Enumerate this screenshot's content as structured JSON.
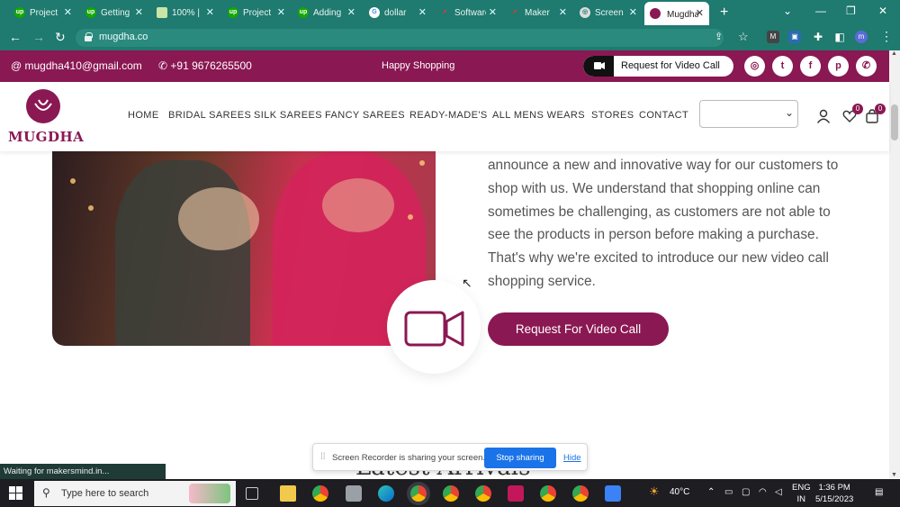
{
  "browser": {
    "tabs": [
      {
        "label": "Project",
        "favicon": "up-icon"
      },
      {
        "label": "Getting",
        "favicon": "up-icon"
      },
      {
        "label": "100% |",
        "favicon": "sheet-icon"
      },
      {
        "label": "Project",
        "favicon": "up-icon"
      },
      {
        "label": "Adding",
        "favicon": "up-icon"
      },
      {
        "label": "dollar",
        "favicon": "google-icon"
      },
      {
        "label": "Software",
        "favicon": "pin-icon"
      },
      {
        "label": "Maker",
        "favicon": "pin-icon"
      },
      {
        "label": "Screen",
        "favicon": "chrome-icon"
      },
      {
        "label": "Mugdha",
        "favicon": "mugdha-icon",
        "active": true
      }
    ],
    "url": "mugdha.co",
    "status_text": "Waiting for makersmind.in..."
  },
  "topbar": {
    "email": "mugdha410@gmail.com",
    "phone": "+91 9676265500",
    "tagline": "Happy Shopping",
    "video_button": "Request for Video Call",
    "social": [
      "instagram-icon",
      "twitter-icon",
      "facebook-icon",
      "pinterest-icon",
      "whatsapp-icon"
    ]
  },
  "header": {
    "logo_text": "MUGDHA",
    "nav": [
      "HOME",
      "BRIDAL SAREES",
      "SILK SAREES",
      "FANCY SAREES",
      "READY-MADE'S",
      "ALL MENS WEARS",
      "STORES",
      "CONTACT"
    ],
    "wishlist_count": "0",
    "cart_count": "0"
  },
  "content": {
    "paragraph": "announce a new and innovative way for our customers to shop with us. We understand that shopping online can sometimes be challenging, as customers are not able to see the products in person before making a purchase. That's why we're excited to introduce our new video call shopping service.",
    "cta": "Request For Video Call",
    "section_heading": "Latest Arrivals"
  },
  "recorder": {
    "message": "Screen Recorder is sharing your screen.",
    "stop": "Stop sharing",
    "hide": "Hide"
  },
  "taskbar": {
    "search_placeholder": "Type here to search",
    "weather": "40°C",
    "lang": "ENG",
    "region": "IN",
    "time": "1:36 PM",
    "date": "5/15/2023"
  },
  "colors": {
    "brand": "#8a1853",
    "chrome": "#1f7a6f",
    "link": "#1a73e8"
  }
}
